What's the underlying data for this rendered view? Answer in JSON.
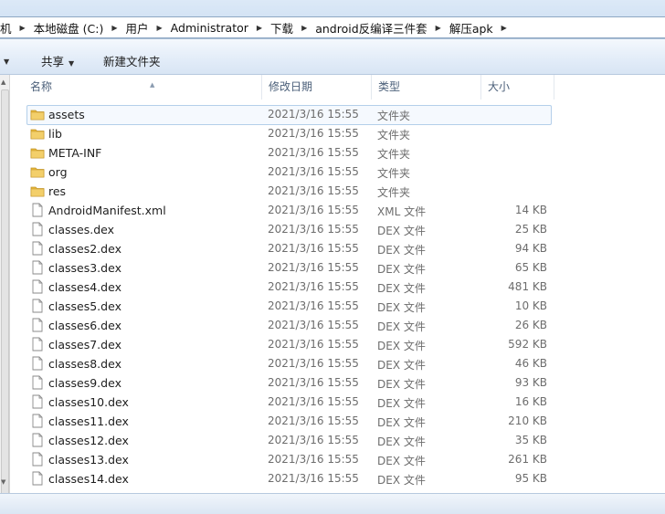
{
  "breadcrumbs": [
    "机",
    "本地磁盘 (C:)",
    "用户",
    "Administrator",
    "下载",
    "android反编译三件套",
    "解压apk"
  ],
  "toolbar": {
    "share_label": "共享",
    "new_folder_label": "新建文件夹"
  },
  "columns": {
    "name": "名称",
    "date": "修改日期",
    "type": "类型",
    "size": "大小"
  },
  "files": [
    {
      "name": "assets",
      "date": "2021/3/16 15:55",
      "type": "文件夹",
      "size": "",
      "kind": "folder",
      "selected": true
    },
    {
      "name": "lib",
      "date": "2021/3/16 15:55",
      "type": "文件夹",
      "size": "",
      "kind": "folder"
    },
    {
      "name": "META-INF",
      "date": "2021/3/16 15:55",
      "type": "文件夹",
      "size": "",
      "kind": "folder"
    },
    {
      "name": "org",
      "date": "2021/3/16 15:55",
      "type": "文件夹",
      "size": "",
      "kind": "folder"
    },
    {
      "name": "res",
      "date": "2021/3/16 15:55",
      "type": "文件夹",
      "size": "",
      "kind": "folder"
    },
    {
      "name": "AndroidManifest.xml",
      "date": "2021/3/16 15:55",
      "type": "XML 文件",
      "size": "14 KB",
      "kind": "file"
    },
    {
      "name": "classes.dex",
      "date": "2021/3/16 15:55",
      "type": "DEX 文件",
      "size": "25 KB",
      "kind": "file"
    },
    {
      "name": "classes2.dex",
      "date": "2021/3/16 15:55",
      "type": "DEX 文件",
      "size": "94 KB",
      "kind": "file"
    },
    {
      "name": "classes3.dex",
      "date": "2021/3/16 15:55",
      "type": "DEX 文件",
      "size": "65 KB",
      "kind": "file"
    },
    {
      "name": "classes4.dex",
      "date": "2021/3/16 15:55",
      "type": "DEX 文件",
      "size": "481 KB",
      "kind": "file"
    },
    {
      "name": "classes5.dex",
      "date": "2021/3/16 15:55",
      "type": "DEX 文件",
      "size": "10 KB",
      "kind": "file"
    },
    {
      "name": "classes6.dex",
      "date": "2021/3/16 15:55",
      "type": "DEX 文件",
      "size": "26 KB",
      "kind": "file"
    },
    {
      "name": "classes7.dex",
      "date": "2021/3/16 15:55",
      "type": "DEX 文件",
      "size": "592 KB",
      "kind": "file"
    },
    {
      "name": "classes8.dex",
      "date": "2021/3/16 15:55",
      "type": "DEX 文件",
      "size": "46 KB",
      "kind": "file"
    },
    {
      "name": "classes9.dex",
      "date": "2021/3/16 15:55",
      "type": "DEX 文件",
      "size": "93 KB",
      "kind": "file"
    },
    {
      "name": "classes10.dex",
      "date": "2021/3/16 15:55",
      "type": "DEX 文件",
      "size": "16 KB",
      "kind": "file"
    },
    {
      "name": "classes11.dex",
      "date": "2021/3/16 15:55",
      "type": "DEX 文件",
      "size": "210 KB",
      "kind": "file"
    },
    {
      "name": "classes12.dex",
      "date": "2021/3/16 15:55",
      "type": "DEX 文件",
      "size": "35 KB",
      "kind": "file"
    },
    {
      "name": "classes13.dex",
      "date": "2021/3/16 15:55",
      "type": "DEX 文件",
      "size": "261 KB",
      "kind": "file"
    },
    {
      "name": "classes14.dex",
      "date": "2021/3/16 15:55",
      "type": "DEX 文件",
      "size": "95 KB",
      "kind": "file"
    }
  ],
  "colors": {
    "folder": "#e8b93b",
    "selection_border": "#b4cfea",
    "header_text": "#4c607a"
  },
  "icons": {
    "folder": "folder-icon",
    "file": "file-icon"
  }
}
